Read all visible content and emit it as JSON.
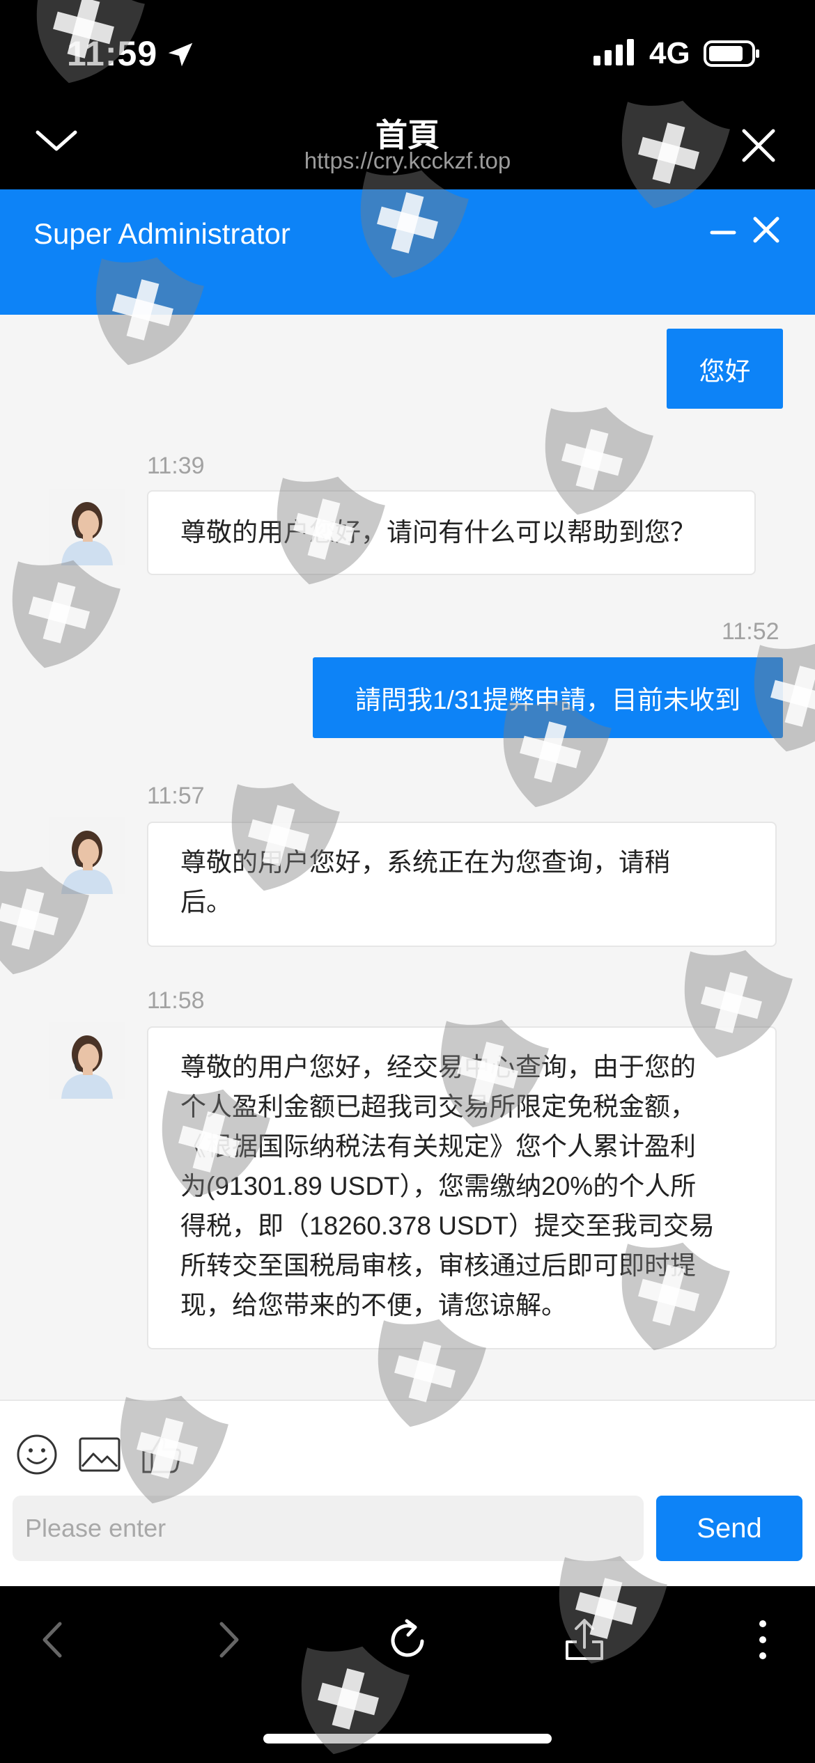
{
  "status": {
    "time": "11:59",
    "network": "4G"
  },
  "browser": {
    "title": "首頁",
    "url": "https://cry.kcckzf.top"
  },
  "chat": {
    "title": "Super Administrator"
  },
  "messages": [
    {
      "side": "out",
      "text": "您好"
    },
    {
      "side": "in",
      "time": "11:39",
      "lines": [
        "尊敬的用户您好，请问有什么可以帮助到您？"
      ]
    },
    {
      "side": "out",
      "time": "11:52",
      "text": "請問我1/31提弊申請，目前未收到"
    },
    {
      "side": "in",
      "time": "11:57",
      "lines": [
        "尊敬的用户您好，系统正在为您查询，请稍",
        "后。"
      ]
    },
    {
      "side": "in",
      "time": "11:58",
      "lines": [
        "尊敬的用户您好，经交易中心查询，由于您的",
        "个人盈利金额已超我司交易所限定免税金额，",
        "《根据国际纳税法有关规定》您个人累计盈利",
        "为(91301.89 USDT），您需缴纳20%的个人所",
        "得税，即（18260.378 USDT）提交至我司交易",
        "所转交至国税局审核，审核通过后即可即时提",
        "现，给您带来的不便，请您谅解。"
      ]
    }
  ],
  "input": {
    "placeholder": "Please enter",
    "send_label": "Send"
  },
  "icons": {
    "toolbar": [
      "emoji-icon",
      "image-icon",
      "thumbs-up-icon"
    ],
    "nav": [
      "back-icon",
      "forward-icon",
      "reload-icon",
      "share-icon",
      "more-icon"
    ]
  },
  "colors": {
    "accent": "#0d83f7",
    "background": "#f5f5f5",
    "watermark": "#7f7f7f"
  }
}
